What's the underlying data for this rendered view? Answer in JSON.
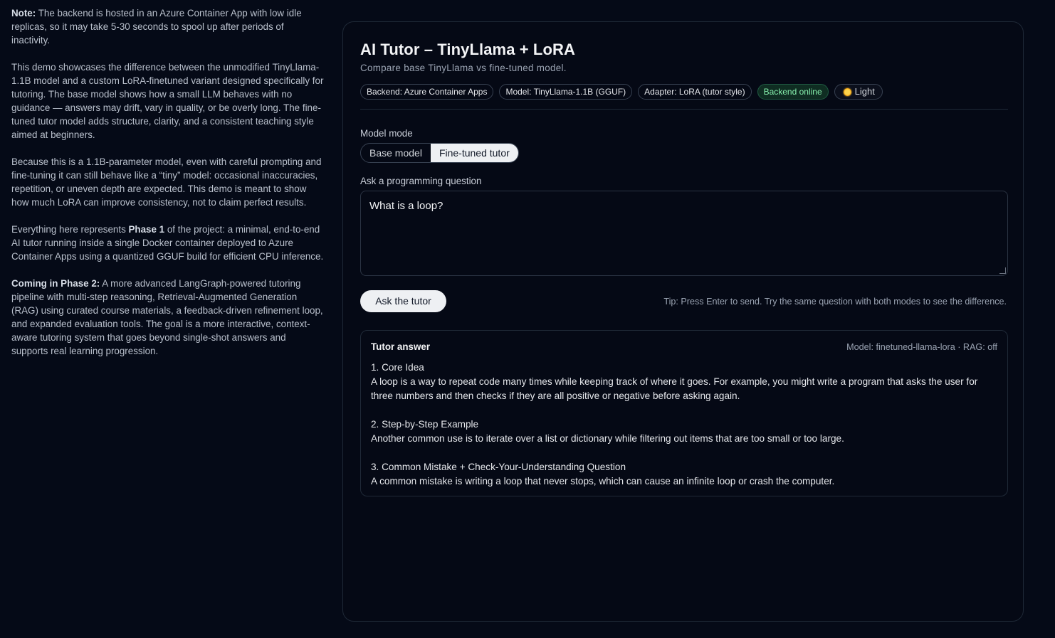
{
  "sidebar": {
    "note_label": "Note:",
    "note_text": " The backend is hosted in an Azure Container App with low idle replicas, so it may take 5-30 seconds to spool up after periods of inactivity.",
    "demo_text": "This demo showcases the difference between the unmodified TinyLlama-1.1B model and a custom LoRA-finetuned variant designed specifically for tutoring. The base model shows how a small LLM behaves with no guidance — answers may drift, vary in quality, or be overly long. The fine-tuned tutor model adds structure, clarity, and a consistent teaching style aimed at beginners.",
    "caveat_text": "Because this is a 1.1B-parameter model, even with careful prompting and fine-tuning it can still behave like a “tiny” model: occasional inaccuracies, repetition, or uneven depth are expected. This demo is meant to show how much LoRA can improve consistency, not to claim perfect results.",
    "phase1_pre": "Everything here represents ",
    "phase1_label": "Phase 1",
    "phase1_post": " of the project: a minimal, end-to-end AI tutor running inside a single Docker container deployed to Azure Container Apps using a quantized GGUF build for efficient CPU inference.",
    "phase2_label": "Coming in Phase 2:",
    "phase2_text": " A more advanced LangGraph-powered tutoring pipeline with multi-step reasoning, Retrieval-Augmented Generation (RAG) using curated course materials, a feedback-driven refinement loop, and expanded evaluation tools. The goal is a more interactive, context-aware tutoring system that goes beyond single-shot answers and supports real learning progression."
  },
  "header": {
    "title": "AI Tutor – TinyLlama + LoRA",
    "subtitle": "Compare base TinyLlama vs fine-tuned model."
  },
  "badges": {
    "backend": "Backend: Azure Container Apps",
    "model": "Model: TinyLlama-1.1B (GGUF)",
    "adapter": "Adapter: LoRA (tutor style)",
    "status": "Backend online",
    "theme_toggle": "Light",
    "status_color": "#86efac"
  },
  "mode": {
    "label": "Model mode",
    "options": [
      "Base model",
      "Fine-tuned tutor"
    ],
    "selected": "Fine-tuned tutor"
  },
  "question": {
    "label": "Ask a programming question",
    "value": "What is a loop?"
  },
  "actions": {
    "ask_label": "Ask the tutor",
    "tip": "Tip: Press Enter to send. Try the same question with both modes to see the difference."
  },
  "answer": {
    "title": "Tutor answer",
    "meta": "Model: finetuned-llama-lora · RAG: off",
    "sections": [
      {
        "heading": "1. Core Idea",
        "text": "A loop is a way to repeat code many times while keeping track of where it goes. For example, you might write a program that asks the user for three numbers and then checks if they are all positive or negative before asking again."
      },
      {
        "heading": "2. Step-by-Step Example",
        "text": "Another common use is to iterate over a list or dictionary while filtering out items that are too small or too large."
      },
      {
        "heading": "3. Common Mistake + Check-Your-Understanding Question",
        "text": "A common mistake is writing a loop that never stops, which can cause an infinite loop or crash the computer."
      }
    ]
  }
}
